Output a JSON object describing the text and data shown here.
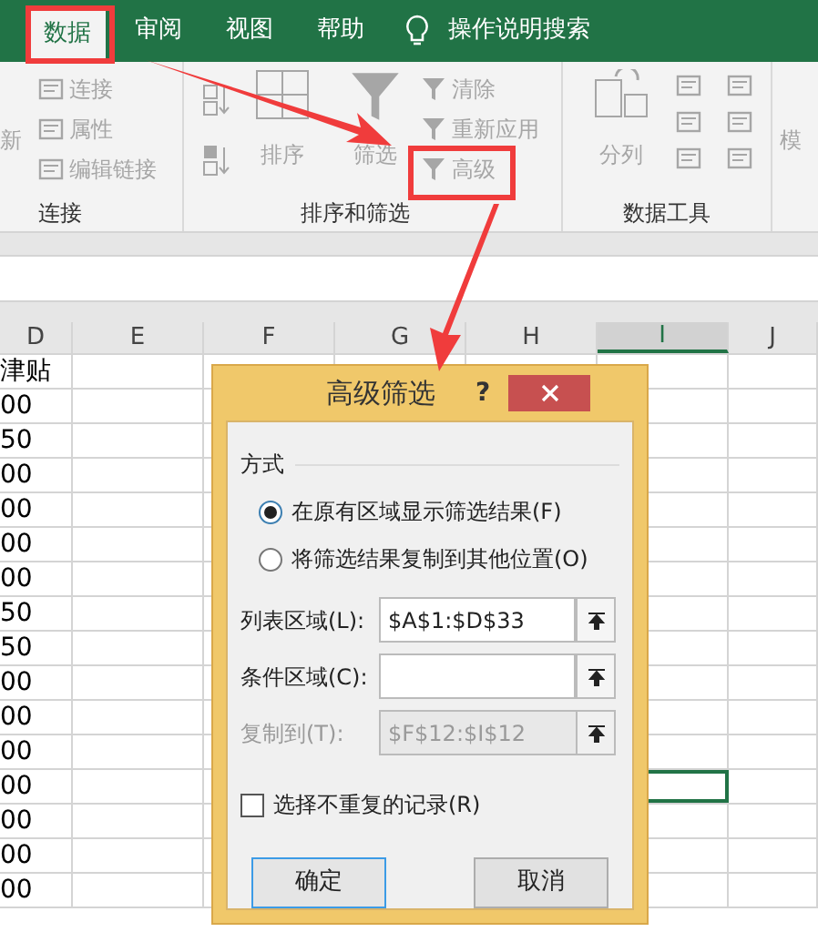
{
  "ribbon_tabs": [
    {
      "label": "数据",
      "selected": true
    },
    {
      "label": "审阅",
      "selected": false
    },
    {
      "label": "视图",
      "selected": false
    },
    {
      "label": "帮助",
      "selected": false
    }
  ],
  "tell_me": "操作说明搜索",
  "ribbon": {
    "refresh_partial": "新",
    "connections": {
      "items": [
        "连接",
        "属性",
        "编辑链接"
      ],
      "label": "连接"
    },
    "sort_filter": {
      "sort": "排序",
      "filter": "筛选",
      "items": [
        "清除",
        "重新应用",
        "高级"
      ],
      "label": "排序和筛选"
    },
    "data_tools": {
      "text_to_columns": "分列",
      "label": "数据工具"
    },
    "what_if_partial": "模"
  },
  "sheet": {
    "columns": [
      {
        "label": "D",
        "selected": false
      },
      {
        "label": "E",
        "selected": false
      },
      {
        "label": "F",
        "selected": false
      },
      {
        "label": "G",
        "selected": false
      },
      {
        "label": "H",
        "selected": false
      },
      {
        "label": "I",
        "selected": true
      },
      {
        "label": "J",
        "selected": false
      }
    ],
    "rows": [
      {
        "d": "津贴",
        "selected": false
      },
      {
        "d": "00",
        "selected": false
      },
      {
        "d": "50",
        "selected": false
      },
      {
        "d": "00",
        "selected": false
      },
      {
        "d": "00",
        "selected": false
      },
      {
        "d": "00",
        "selected": false
      },
      {
        "d": "00",
        "selected": false
      },
      {
        "d": "50",
        "selected": false
      },
      {
        "d": "50",
        "selected": false
      },
      {
        "d": "00",
        "selected": false
      },
      {
        "d": "00",
        "selected": false
      },
      {
        "d": "00",
        "selected": false
      },
      {
        "d": "00",
        "selected": true
      },
      {
        "d": "00",
        "selected": false
      },
      {
        "d": "00",
        "selected": false
      },
      {
        "d": "00",
        "selected": false
      }
    ]
  },
  "dialog": {
    "title": "高级筛选",
    "help": "?",
    "group_label": "方式",
    "modes": [
      {
        "label": "在原有区域显示筛选结果(F)",
        "selected": true
      },
      {
        "label": "将筛选结果复制到其他位置(O)",
        "selected": false
      }
    ],
    "fields": [
      {
        "label": "列表区域(L):",
        "value": "$A$1:$D$33",
        "disabled": false
      },
      {
        "label": "条件区域(C):",
        "disabled": false
      },
      {
        "label": "复制到(T):",
        "value": "$F$12:$I$12",
        "disabled": true
      }
    ],
    "unique": {
      "label": "选择不重复的记录(R)",
      "checked": false
    },
    "buttons": [
      {
        "label": "确定",
        "default": true
      },
      {
        "label": "取消",
        "default": false
      }
    ]
  }
}
